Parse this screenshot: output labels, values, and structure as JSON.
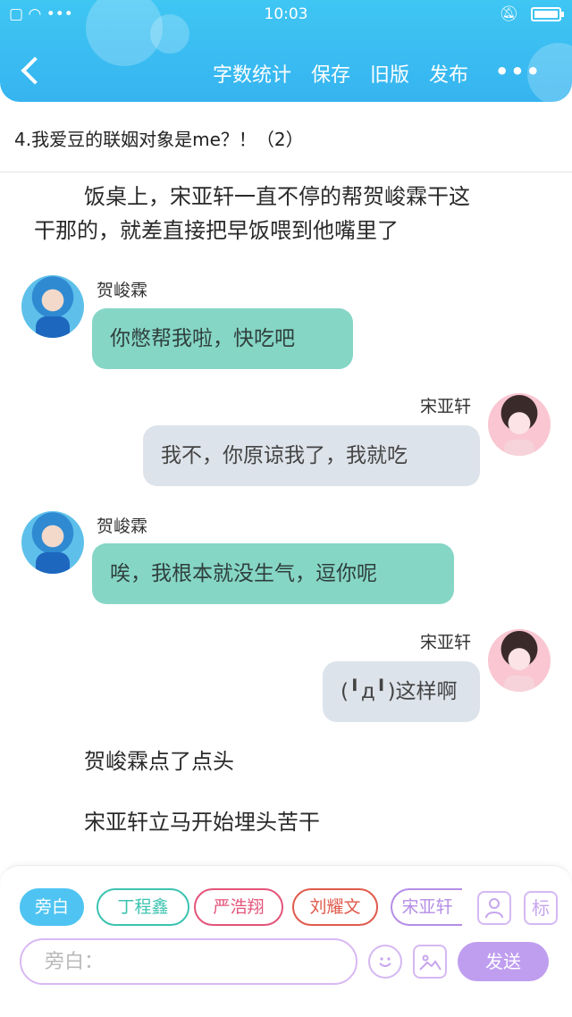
{
  "status": {
    "time": "10:03",
    "left_icons": "▢ ◠ •••",
    "battery_level": 1.0
  },
  "header": {
    "back_icon": "chevron-left-icon",
    "actions": [
      "字数统计",
      "保存",
      "旧版",
      "发布"
    ],
    "more": "•••"
  },
  "doc": {
    "title": "4.我爱豆的联姻对象是me？！（2）"
  },
  "content": {
    "narration1_line1": "饭桌上，宋亚轩一直不停的帮贺峻霖干这",
    "narration1_line2": "干那的，就差直接把早饭喂到他嘴里了",
    "messages": [
      {
        "speaker": "贺峻霖",
        "text": "你憋帮我啦，快吃吧"
      },
      {
        "speaker": "宋亚轩",
        "text": "我不，你原谅我了，我就吃"
      },
      {
        "speaker": "贺峻霖",
        "text": "唉，我根本就没生气，逗你呢"
      },
      {
        "speaker": "宋亚轩",
        "text": "(╹д╹)这样啊"
      }
    ],
    "narration2": "贺峻霖点了点头",
    "narration3": "宋亚轩立马开始埋头苦干"
  },
  "composer": {
    "chips": [
      "旁白",
      "丁程鑫",
      "严浩翔",
      "刘耀文",
      "宋亚轩"
    ],
    "chip_colors": [
      "#4fc4f2",
      "#3cc3b0",
      "#e4547a",
      "#e05a4b",
      "#b58ee6"
    ],
    "role_icon": "user-icon",
    "tag_label": "标",
    "input_placeholder": "旁白：",
    "emoji_icon": "smile-icon",
    "image_icon": "image-icon",
    "send_label": "发送"
  }
}
